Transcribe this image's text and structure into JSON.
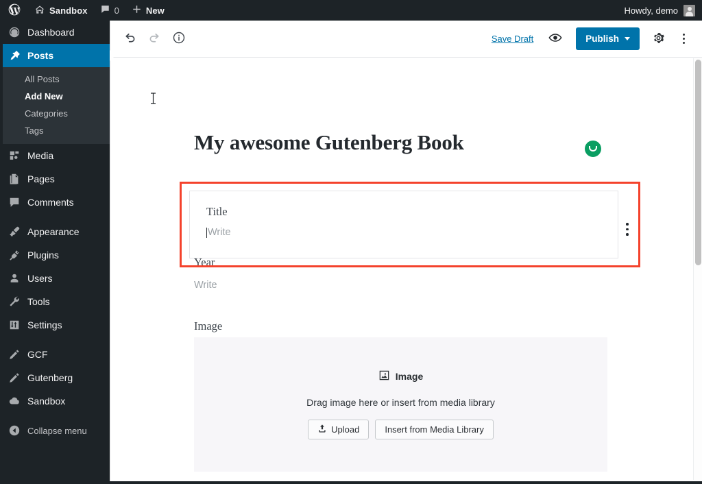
{
  "adminbar": {
    "logo_icon": "wordpress-logo-icon",
    "site_icon": "home-icon",
    "site_name": "Sandbox",
    "comments_icon": "comment-bubble-icon",
    "comment_count": "0",
    "new_icon": "plus-icon",
    "new_label": "New",
    "howdy": "Howdy, demo",
    "avatar_icon": "user-avatar"
  },
  "sidebar": {
    "items": [
      {
        "label": "Dashboard",
        "icon": "dashboard-gauge-icon",
        "current": false
      },
      {
        "label": "Posts",
        "icon": "pin-icon",
        "current": true
      },
      {
        "label": "Media",
        "icon": "media-icon",
        "current": false
      },
      {
        "label": "Pages",
        "icon": "pages-icon",
        "current": false
      },
      {
        "label": "Comments",
        "icon": "comment-bubble-icon",
        "current": false
      },
      {
        "label": "Appearance",
        "icon": "paintbrush-icon",
        "current": false
      },
      {
        "label": "Plugins",
        "icon": "plug-icon",
        "current": false
      },
      {
        "label": "Users",
        "icon": "user-icon",
        "current": false
      },
      {
        "label": "Tools",
        "icon": "wrench-icon",
        "current": false
      },
      {
        "label": "Settings",
        "icon": "sliders-icon",
        "current": false
      },
      {
        "label": "GCF",
        "icon": "pencil-icon",
        "current": false
      },
      {
        "label": "Gutenberg",
        "icon": "pencil-icon",
        "current": false
      },
      {
        "label": "Sandbox",
        "icon": "cloud-icon",
        "current": false
      }
    ],
    "submenu": [
      {
        "label": "All Posts",
        "current": false
      },
      {
        "label": "Add New",
        "current": true
      },
      {
        "label": "Categories",
        "current": false
      },
      {
        "label": "Tags",
        "current": false
      }
    ],
    "collapse": {
      "label": "Collapse menu",
      "icon": "arrow-left-circle-icon"
    }
  },
  "toolbar": {
    "undo_icon": "undo-arrow-icon",
    "redo_icon": "redo-arrow-icon",
    "info_icon": "info-circle-icon",
    "save_draft_label": "Save Draft",
    "preview_icon": "eye-icon",
    "publish_label": "Publish",
    "settings_icon": "gear-icon",
    "more_icon": "more-vertical-icon"
  },
  "post": {
    "title": "My awesome Gutenberg Book",
    "status_icon": "saved-check-circle-icon"
  },
  "blocks": {
    "title_field": {
      "label": "Title",
      "placeholder": "Write",
      "menu_icon": "block-more-vertical-icon",
      "highlight_color": "#f4422c"
    },
    "year_field": {
      "label": "Year",
      "placeholder": "Write"
    },
    "image_field": {
      "label": "Image",
      "placeholder_icon": "image-placeholder-icon",
      "placeholder_title": "Image",
      "hint": "Drag image here or insert from media library",
      "upload_label": "Upload",
      "upload_icon": "upload-icon",
      "media_library_label": "Insert from Media Library"
    }
  },
  "colors": {
    "admin_dark": "#1d2327",
    "accent_blue": "#0073aa",
    "highlight_red": "#f4422c",
    "status_green": "#0a9e62"
  }
}
